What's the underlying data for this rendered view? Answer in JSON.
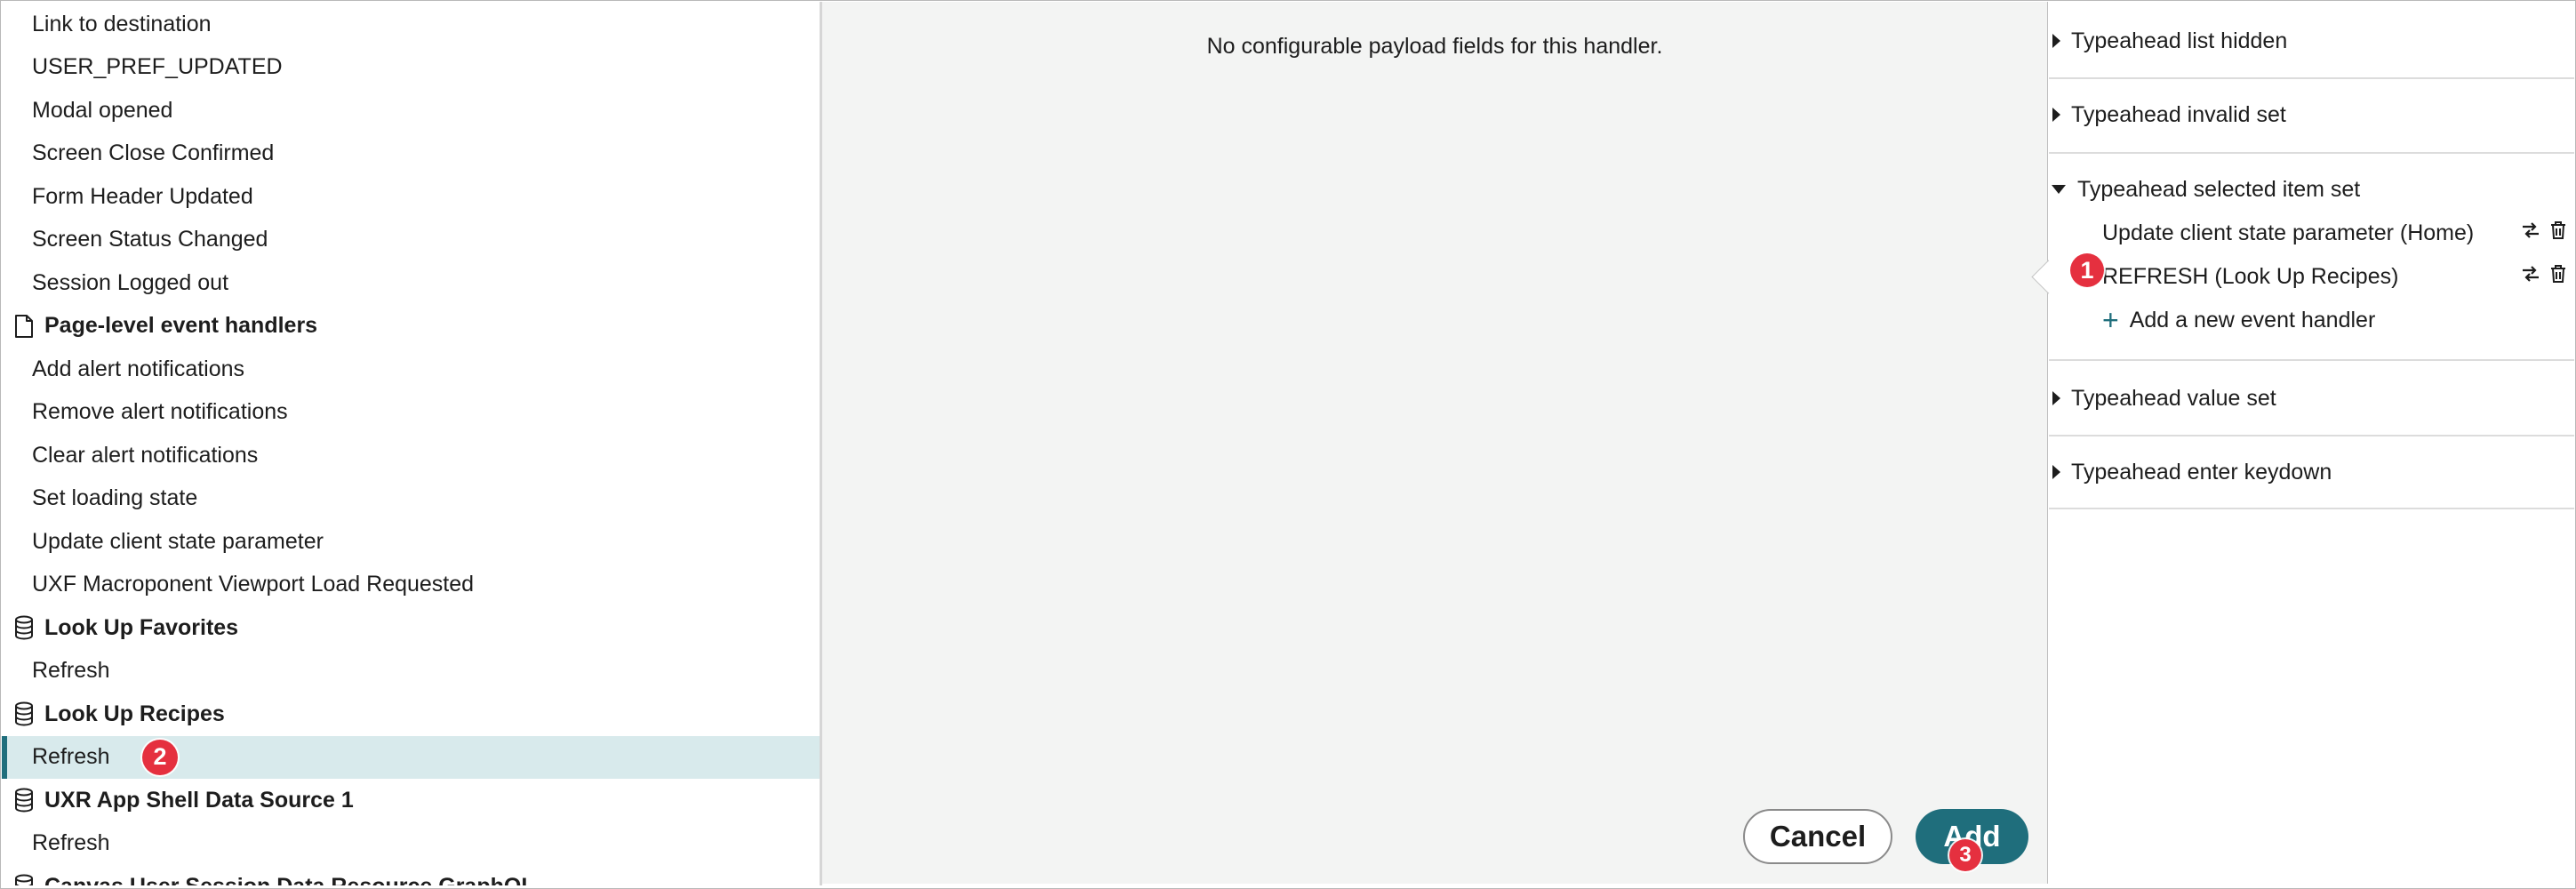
{
  "left_list": {
    "rows": [
      {
        "type": "item",
        "label": "Link to destination"
      },
      {
        "type": "item",
        "label": "USER_PREF_UPDATED"
      },
      {
        "type": "item",
        "label": "Modal opened"
      },
      {
        "type": "item",
        "label": "Screen Close Confirmed"
      },
      {
        "type": "item",
        "label": "Form Header Updated"
      },
      {
        "type": "item",
        "label": "Screen Status Changed"
      },
      {
        "type": "item",
        "label": "Session Logged out"
      },
      {
        "type": "group",
        "icon": "page-icon",
        "label": "Page-level event handlers"
      },
      {
        "type": "item",
        "label": "Add alert notifications"
      },
      {
        "type": "item",
        "label": "Remove alert notifications"
      },
      {
        "type": "item",
        "label": "Clear alert notifications"
      },
      {
        "type": "item",
        "label": "Set loading state"
      },
      {
        "type": "item",
        "label": "Update client state parameter"
      },
      {
        "type": "item",
        "label": "UXF Macroponent Viewport Load Requested"
      },
      {
        "type": "group",
        "icon": "database-icon",
        "label": "Look Up Favorites"
      },
      {
        "type": "item",
        "label": "Refresh"
      },
      {
        "type": "group",
        "icon": "database-icon",
        "label": "Look Up Recipes"
      },
      {
        "type": "item",
        "label": "Refresh",
        "selected": true
      },
      {
        "type": "group",
        "icon": "database-icon",
        "label": "UXR App Shell Data Source 1"
      },
      {
        "type": "item",
        "label": "Refresh"
      },
      {
        "type": "group",
        "icon": "database-icon",
        "label": "Canvas User Session Data Resource GraphQL"
      }
    ]
  },
  "modal": {
    "message": "No configurable payload fields for this handler.",
    "cancel_label": "Cancel",
    "add_label": "Add"
  },
  "right_panel": {
    "sections": [
      {
        "label": "Typeahead list hidden",
        "expanded": false
      },
      {
        "label": "Typeahead invalid set",
        "expanded": false
      },
      {
        "label": "Typeahead selected item set",
        "expanded": true,
        "handlers": [
          "Update client state parameter (Home)",
          "REFRESH (Look Up Recipes)"
        ],
        "add_label": "Add a new event handler"
      },
      {
        "label": "Typeahead value set",
        "expanded": false
      },
      {
        "label": "Typeahead enter keydown",
        "expanded": false
      }
    ]
  },
  "badges": [
    "1",
    "2",
    "3"
  ],
  "colors": {
    "accent": "#1f6e7c",
    "selected_row": "#d8eaec",
    "badge": "#e5303f",
    "modal_bg": "#f3f4f3"
  }
}
